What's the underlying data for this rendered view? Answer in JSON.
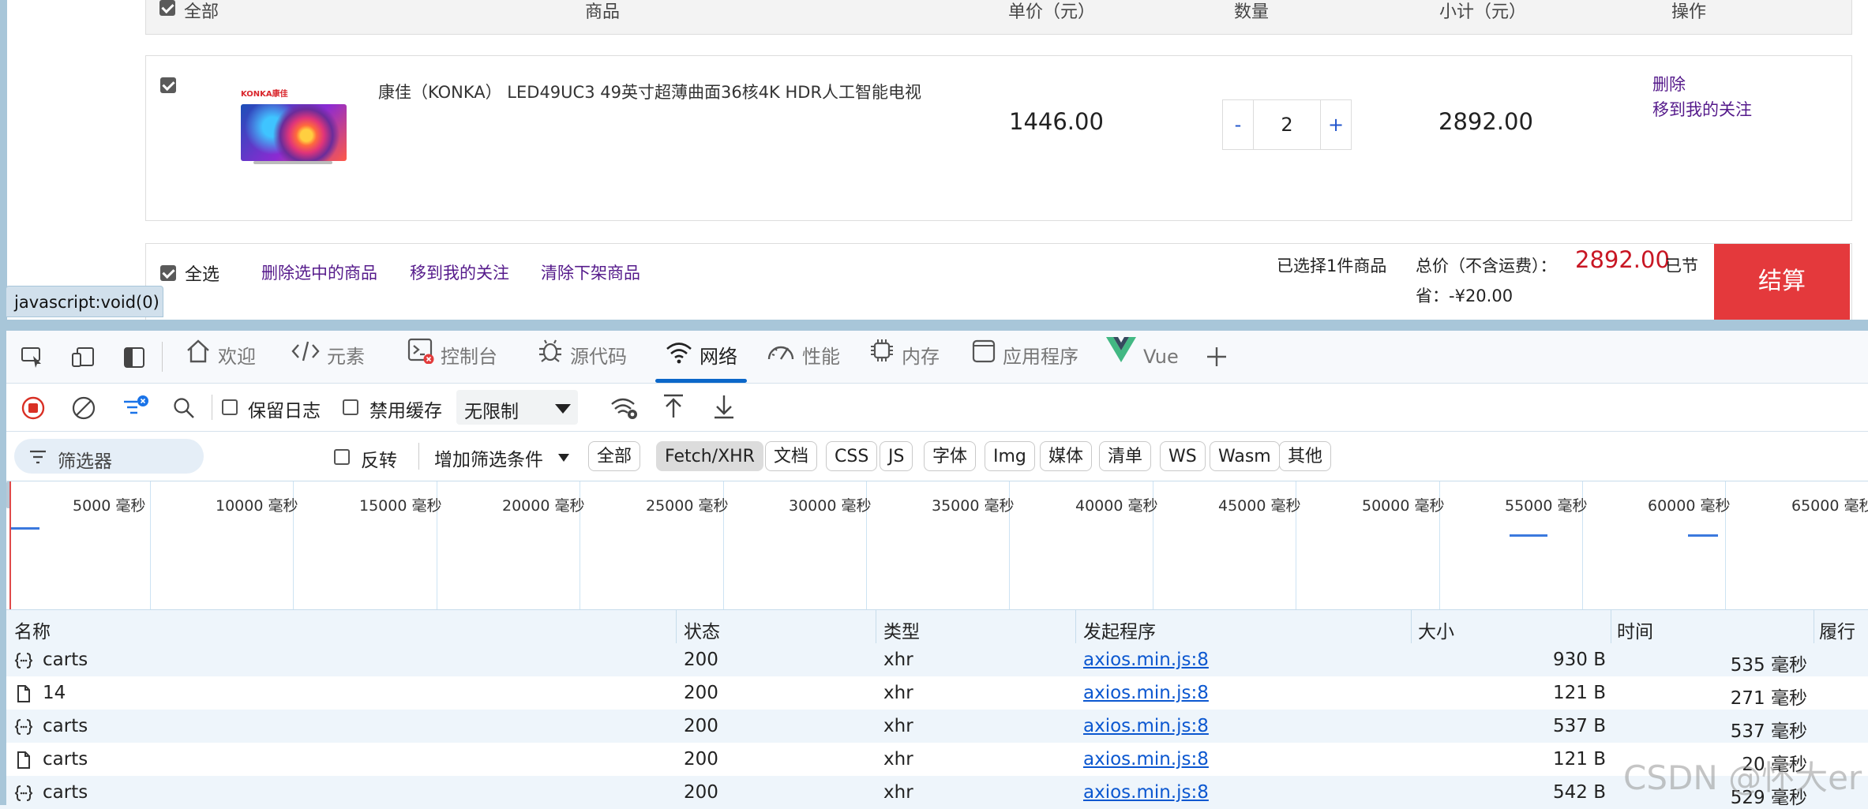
{
  "cart": {
    "header": {
      "select_all": "全部",
      "product": "商品",
      "unit_price": "单价（元）",
      "quantity": "数量",
      "subtotal": "小计（元）",
      "action": "操作"
    },
    "item": {
      "brand_on_image": "KONKA康佳",
      "title": "康佳（KONKA） LED49UC3 49英寸超薄曲面36核4K HDR人工智能电视",
      "unit_price": "1446.00",
      "quantity": "2",
      "minus": "-",
      "plus": "+",
      "subtotal": "2892.00",
      "delete": "删除",
      "move_to_favorites": "移到我的关注"
    },
    "footer": {
      "select_all": "全选",
      "delete_selected": "删除选中的商品",
      "move_to_favorites": "移到我的关注",
      "clear_offshelf": "清除下架商品",
      "selected_count": "已选择1件商品",
      "total_label": "总价（不含运费）：",
      "total_value": "2892.00",
      "saved_prefix": "已节",
      "saved_line": "省：-¥20.00",
      "checkout": "结算"
    },
    "status_tooltip": "javascript:void(0)"
  },
  "devtools": {
    "tabs": [
      {
        "label": "欢迎",
        "icon": "home-icon"
      },
      {
        "label": "元素",
        "icon": "code-icon"
      },
      {
        "label": "控制台",
        "icon": "console-icon"
      },
      {
        "label": "源代码",
        "icon": "bug-icon"
      },
      {
        "label": "网络",
        "icon": "wifi-icon",
        "active": true
      },
      {
        "label": "性能",
        "icon": "gauge-icon"
      },
      {
        "label": "内存",
        "icon": "chip-icon"
      },
      {
        "label": "应用程序",
        "icon": "app-icon"
      },
      {
        "label": "Vue",
        "icon": "vue-icon"
      }
    ],
    "toolbar": {
      "preserve_log": "保留日志",
      "disable_cache": "禁用缓存",
      "throttle": "无限制"
    },
    "filter": {
      "placeholder": "筛选器",
      "invert": "反转",
      "more_filters": "增加筛选条件",
      "types": [
        "全部",
        "Fetch/XHR",
        "文档",
        "CSS",
        "JS",
        "字体",
        "Img",
        "媒体",
        "清单",
        "WS",
        "Wasm",
        "其他"
      ],
      "active_type": "Fetch/XHR"
    },
    "timeline": {
      "ticks": [
        "5000 毫秒",
        "10000 毫秒",
        "15000 毫秒",
        "20000 毫秒",
        "25000 毫秒",
        "30000 毫秒",
        "35000 毫秒",
        "40000 毫秒",
        "45000 毫秒",
        "50000 毫秒",
        "55000 毫秒",
        "60000 毫秒",
        "65000 毫秒"
      ]
    },
    "table": {
      "columns": [
        "名称",
        "状态",
        "类型",
        "发起程序",
        "大小",
        "时间",
        "履行者"
      ],
      "rows": [
        {
          "icon": "xhr-icon",
          "name": "carts",
          "status": "200",
          "type": "xhr",
          "initiator": "axios.min.js:8",
          "size": "930 B",
          "time": "535 毫秒"
        },
        {
          "icon": "document-icon",
          "name": "14",
          "status": "200",
          "type": "xhr",
          "initiator": "axios.min.js:8",
          "size": "121 B",
          "time": "271 毫秒"
        },
        {
          "icon": "xhr-icon",
          "name": "carts",
          "status": "200",
          "type": "xhr",
          "initiator": "axios.min.js:8",
          "size": "537 B",
          "time": "537 毫秒"
        },
        {
          "icon": "document-icon",
          "name": "carts",
          "status": "200",
          "type": "xhr",
          "initiator": "axios.min.js:8",
          "size": "121 B",
          "time": "20 毫秒"
        },
        {
          "icon": "xhr-icon",
          "name": "carts",
          "status": "200",
          "type": "xhr",
          "initiator": "axios.min.js:8",
          "size": "542 B",
          "time": "529 毫秒"
        }
      ]
    }
  },
  "watermark": "CSDN @怀大er"
}
